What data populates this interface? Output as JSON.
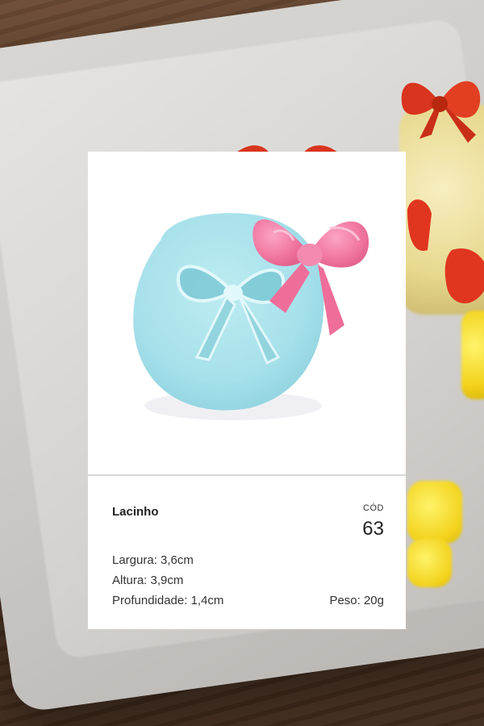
{
  "product": {
    "name": "Lacinho",
    "code_label": "CÓD",
    "code_value": "63",
    "specs": {
      "largura": "Largura: 3,6cm",
      "altura": "Altura: 3,9cm",
      "profundidade": "Profundidade: 1,4cm",
      "peso": "Peso: 20g"
    }
  },
  "colors": {
    "card_bg": "#ffffff",
    "mold_blue": "#a9e3ec",
    "bow_pink": "#f27aa3",
    "bg_soap_red": "#e0351f",
    "bg_soap_yellow": "#f2d21b"
  }
}
